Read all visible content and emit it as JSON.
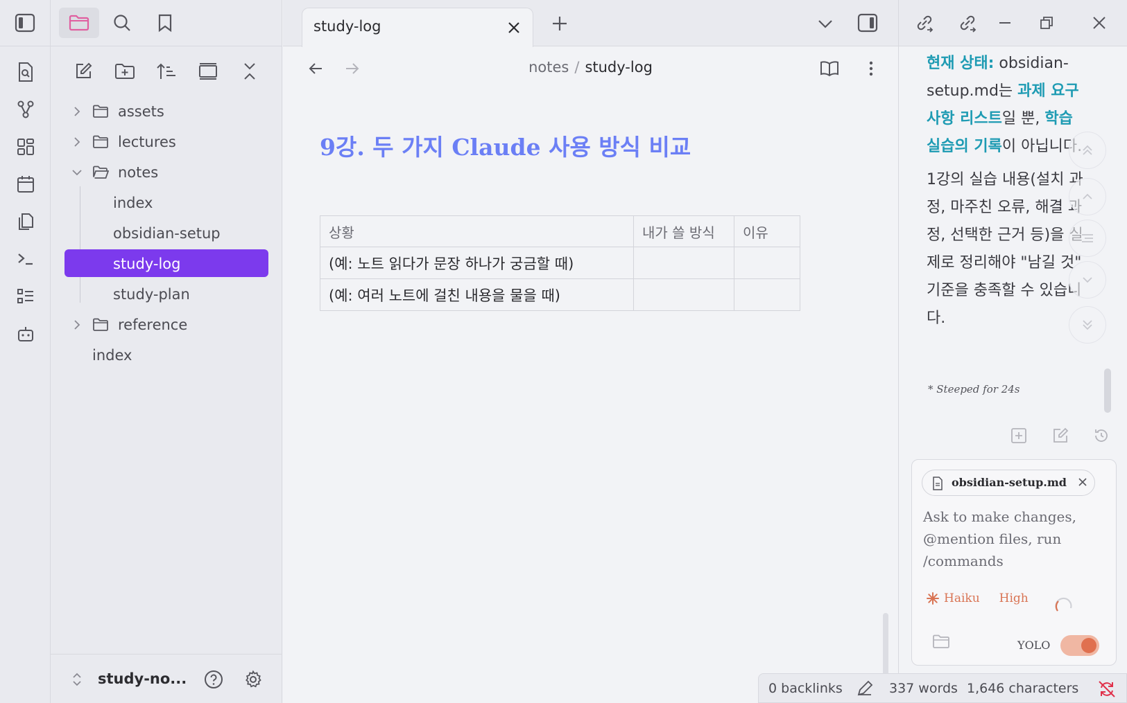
{
  "tab": {
    "title": "study-log"
  },
  "breadcrumb": {
    "parent": "notes",
    "separator": "/",
    "current": "study-log"
  },
  "note": {
    "title": "9강. 두 가지 Claude 사용 방식 비교",
    "table": {
      "headers": [
        "상황",
        "내가 쓸 방식",
        "이유"
      ],
      "rows": [
        [
          "(예: 노트 읽다가 문장 하나가 궁금할 때)",
          "",
          ""
        ],
        [
          "(예: 여러 노트에 걸친 내용을 물을 때)",
          "",
          ""
        ]
      ]
    }
  },
  "file_tree": [
    {
      "type": "folder",
      "label": "assets",
      "expanded": false
    },
    {
      "type": "folder",
      "label": "lectures",
      "expanded": false
    },
    {
      "type": "folder",
      "label": "notes",
      "expanded": true
    },
    {
      "type": "file",
      "label": "index"
    },
    {
      "type": "file",
      "label": "obsidian-setup"
    },
    {
      "type": "file",
      "label": "study-log",
      "selected": true
    },
    {
      "type": "file",
      "label": "study-plan"
    },
    {
      "type": "folder",
      "label": "reference",
      "expanded": false
    },
    {
      "type": "root-file",
      "label": "index"
    }
  ],
  "vault": {
    "name": "study-no..."
  },
  "chat": {
    "p1_highlight1": "현재 상태:",
    "p1_text1": " obsidian-setup.md는 ",
    "p1_highlight2": "과제 요구사항 리스트",
    "p1_text2": "일 뿐, ",
    "p1_highlight3": "학습 실습의 기록",
    "p1_text3": "이 아닙니다.",
    "p2": "1강의 실습 내용(설치 과정, 마주친 오류, 해결 과정, 선택한 근거 등)을 실제로 정리해야 \"남길 것\" 기준을 충족할 수 있습니다.",
    "steeped": "* Steeped for 24s"
  },
  "composer": {
    "file_chip": "obsidian-setup.md",
    "placeholder": "Ask to make changes, @mention files, run /commands",
    "model": "Haiku",
    "effort": "High",
    "yolo_label": "YOLO",
    "yolo_on": true
  },
  "status": {
    "backlinks": "0 backlinks",
    "words": "337 words",
    "characters": "1,646 characters"
  },
  "colors": {
    "accent": "#7c3aed",
    "heading": "#6b7ff5",
    "highlight": "#1e9bb3",
    "claude": "#d97454"
  }
}
